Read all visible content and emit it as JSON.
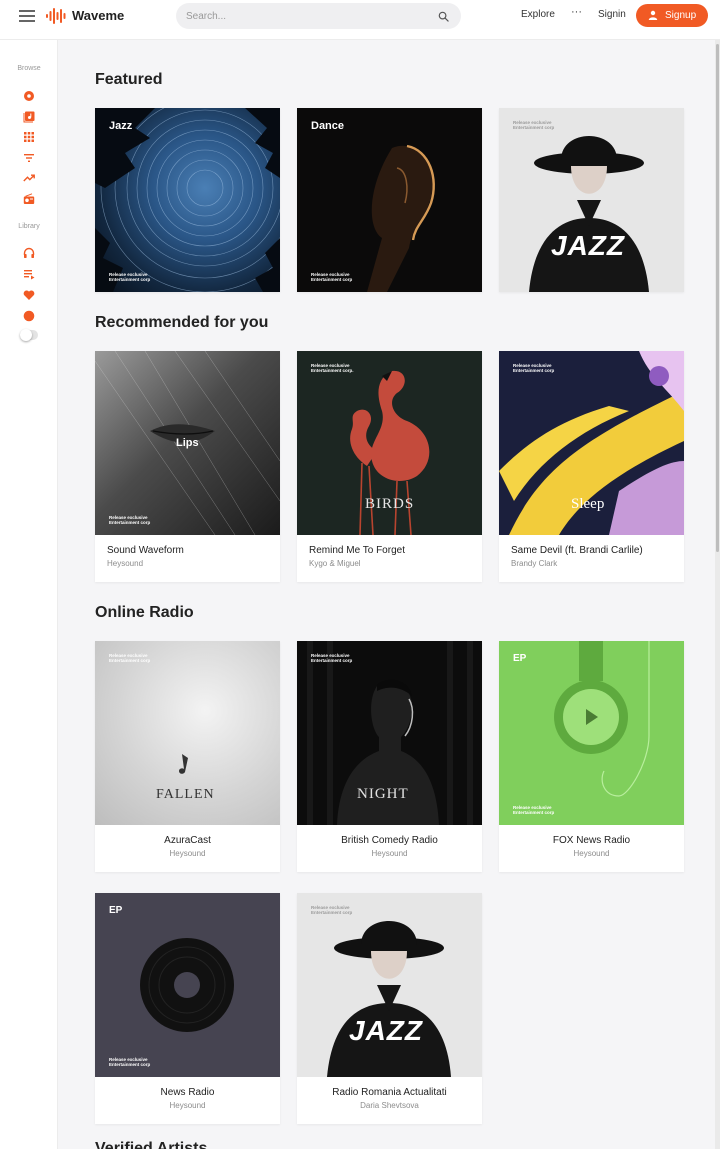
{
  "app": {
    "name": "Waveme"
  },
  "header": {
    "search_placeholder": "Search...",
    "explore_label": "Explore",
    "more_label": "···",
    "signin_label": "Signin",
    "signup_label": "Signup",
    "brand_color": "#f15a24"
  },
  "sidebar": {
    "browse_label": "Browse",
    "library_label": "Library",
    "browse_icons": [
      "disc-icon",
      "album-icon",
      "grid-icon",
      "filter-icon",
      "trending-icon",
      "radio-icon"
    ],
    "library_icons": [
      "headphones-icon",
      "playlist-icon",
      "heart-icon",
      "circle-icon",
      "theme-toggle"
    ]
  },
  "sections": {
    "featured": {
      "title": "Featured",
      "covers": [
        {
          "cover_text": "Jazz",
          "caption": "Release exclusive\nEntertainment corp"
        },
        {
          "cover_text": "Dance",
          "caption": "Release exclusive\nEntertainment corp"
        },
        {
          "cover_text": "JAZZ",
          "caption": "Release exclusive\nEntertainment corp"
        }
      ]
    },
    "recommended": {
      "title": "Recommended for you",
      "items": [
        {
          "title": "Sound Waveform",
          "artist": "Heysound",
          "cover_text": "Lips",
          "caption": "Release exclusive\nEntertainment corp"
        },
        {
          "title": "Remind Me To Forget",
          "artist": "Kygo & Miguel",
          "cover_text": "BIRDS",
          "caption": "Release exclusive\nEntertainment corp."
        },
        {
          "title": "Same Devil (ft. Brandi Carlile)",
          "artist": "Brandy Clark",
          "cover_text": "Sleep",
          "caption": "Release exclusive\nEntertainment corp"
        }
      ]
    },
    "radio": {
      "title": "Online Radio",
      "items": [
        {
          "title": "AzuraCast",
          "artist": "Heysound",
          "cover_text": "FALLEN",
          "caption": "Release exclusive\nEntertainment corp"
        },
        {
          "title": "British Comedy Radio",
          "artist": "Heysound",
          "cover_text": "NIGHT",
          "caption": "Release exclusive\nEntertainment corp"
        },
        {
          "title": "FOX News Radio",
          "artist": "Heysound",
          "cover_text": "EP",
          "caption": "Release exclusive\nEntertainment corp"
        },
        {
          "title": "News Radio",
          "artist": "Heysound",
          "cover_text": "EP",
          "caption": "Release exclusive\nEntertainment corp"
        },
        {
          "title": "Radio Romania Actualitati",
          "artist": "Daria Shevtsova",
          "cover_text": "JAZZ",
          "caption": "Release exclusive\nEntertainment corp"
        }
      ]
    },
    "verified": {
      "title": "Verified Artists"
    }
  }
}
